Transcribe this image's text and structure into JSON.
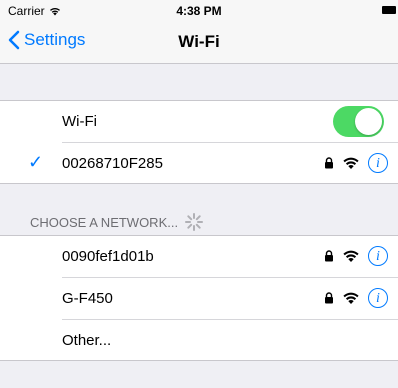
{
  "status_bar": {
    "carrier": "Carrier",
    "time": "4:38 PM"
  },
  "nav": {
    "back_label": "Settings",
    "title": "Wi-Fi"
  },
  "wifi_toggle": {
    "label": "Wi-Fi",
    "on": true
  },
  "current_network": {
    "name": "00268710F285",
    "locked": true
  },
  "section_header": "CHOOSE A NETWORK...",
  "networks": [
    {
      "name": "0090fef1d01b",
      "locked": true
    },
    {
      "name": "G-F450",
      "locked": true
    }
  ],
  "other_label": "Other...",
  "colors": {
    "accent": "#007aff",
    "toggle_on": "#4cd964",
    "background": "#efeff4"
  }
}
